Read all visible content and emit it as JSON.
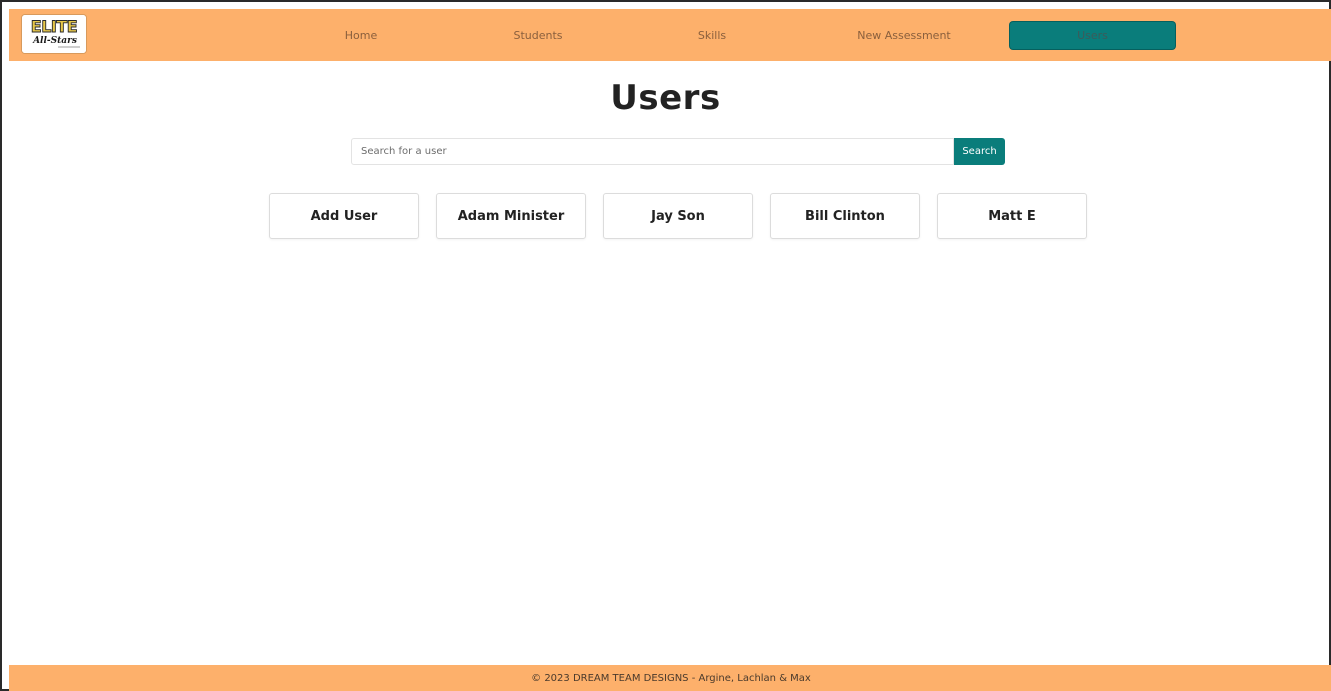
{
  "logo": {
    "text_top": "ELITE",
    "text_script": "All-Stars",
    "tiny_text": "CHEER • DANCE"
  },
  "nav": {
    "items": [
      {
        "label": "Home"
      },
      {
        "label": "Students"
      },
      {
        "label": "Skills"
      },
      {
        "label": "New Assessment"
      },
      {
        "label": "Users"
      }
    ],
    "active": "Users"
  },
  "page": {
    "title": "Users"
  },
  "search": {
    "placeholder": "Search for a user",
    "value": "",
    "button_label": "Search"
  },
  "user_cards": [
    {
      "label": "Add User"
    },
    {
      "label": "Adam Minister"
    },
    {
      "label": "Jay Son"
    },
    {
      "label": "Bill Clinton"
    },
    {
      "label": "Matt E"
    }
  ],
  "footer": {
    "text": "© 2023 DREAM TEAM DESIGNS - Argine, Lachlan & Max"
  },
  "colors": {
    "navbar_bg": "#fdb06b",
    "accent_teal": "#0a7d7b",
    "footer_bg": "#fdb06b"
  }
}
